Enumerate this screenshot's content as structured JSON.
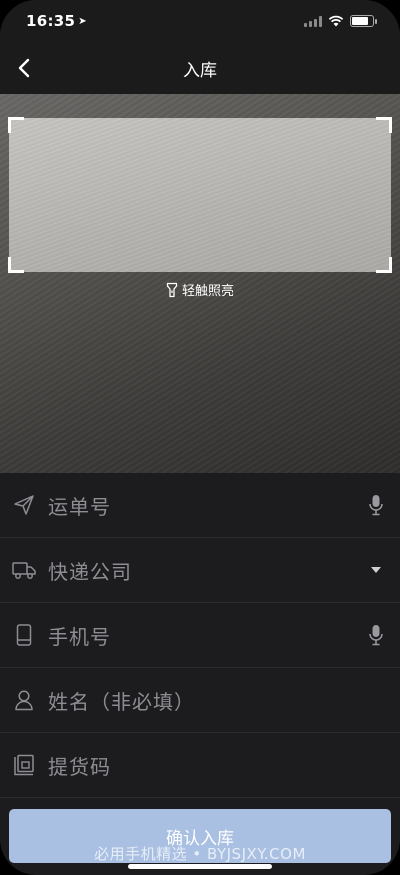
{
  "status_bar": {
    "time": "16:35"
  },
  "nav": {
    "title": "入库"
  },
  "scanner": {
    "torch_label": "轻触照亮"
  },
  "form": {
    "rows": [
      {
        "label": "运单号",
        "icon": "send-icon",
        "trailing": "microphone-icon"
      },
      {
        "label": "快递公司",
        "icon": "truck-icon",
        "trailing": "dropdown-arrow-icon"
      },
      {
        "label": "手机号",
        "icon": "phone-icon",
        "trailing": "microphone-icon"
      },
      {
        "label": "姓名（非必填）",
        "icon": "user-icon",
        "trailing": ""
      },
      {
        "label": "提货码",
        "icon": "pickup-code-icon",
        "trailing": ""
      }
    ]
  },
  "actions": {
    "confirm_label": "确认入库"
  },
  "watermark": {
    "text": "必用手机精选 • BYJSJXY.COM"
  },
  "colors": {
    "background": "#1c1c1e",
    "confirm_button": "#a9c0e3",
    "placeholder": "#8d8d92"
  }
}
